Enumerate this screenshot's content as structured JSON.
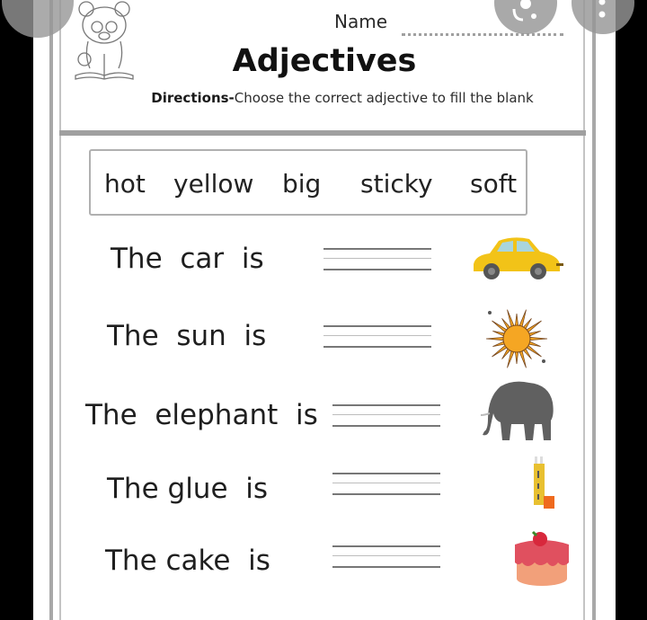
{
  "worksheet": {
    "name_label": "Name",
    "title": "Adjectives",
    "directions_bold": "Directions-",
    "directions_text": "Choose the correct adjective to fill the blank",
    "word_bank": [
      "hot",
      "yellow",
      "big",
      "sticky",
      "soft"
    ],
    "sentences": [
      {
        "text": "The  car  is",
        "picture": "car-icon"
      },
      {
        "text": "The  sun  is",
        "picture": "sun-icon"
      },
      {
        "text": "The  elephant  is",
        "picture": "elephant-icon"
      },
      {
        "text": "The glue  is",
        "picture": "glue-icon"
      },
      {
        "text": "The cake  is",
        "picture": "cake-icon"
      }
    ],
    "header_illustration": "bear-reading-icon"
  },
  "overlay": {
    "close_button": "close-icon",
    "lens_button": "google-lens-icon",
    "more_button": "more-vert-icon"
  },
  "colors": {
    "frame_gray": "#a8a8a8",
    "text": "#1f1f1f",
    "car_yellow": "#f2c318",
    "sun_orange": "#f5a623",
    "elephant_gray": "#606060",
    "cake_pink": "#e0505f",
    "overlay_gray": "#969696"
  }
}
